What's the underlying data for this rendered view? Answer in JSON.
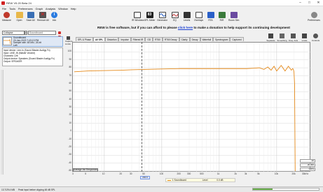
{
  "window": {
    "title": "REW V5.20 Beta 24"
  },
  "menu": [
    "File",
    "Tools",
    "Preferences",
    "Graph",
    "Analysis",
    "Window",
    "Help"
  ],
  "toolbar": {
    "items": [
      {
        "label": "Measure"
      },
      {
        "label": "Open"
      },
      {
        "label": "Save All"
      },
      {
        "label": "Remove All"
      },
      {
        "label": "Info"
      },
      {
        "label": "IR Windows"
      },
      {
        "label": "SPL Meter"
      },
      {
        "label": "Generator"
      },
      {
        "label": "EQ"
      },
      {
        "label": "Levels"
      },
      {
        "label": "Overlays"
      },
      {
        "label": "RTA"
      },
      {
        "label": "RIR"
      },
      {
        "label": "Room Sim"
      },
      {
        "label": "Preferences"
      }
    ],
    "spl_value": "83"
  },
  "banner": {
    "pre": "REW is free software, but if you can afford to please",
    "link": "click here",
    "post": "to make a donation to help support its continuing development"
  },
  "left": {
    "sort_label": "Collapse",
    "filter_value": "Soundboard",
    "card": {
      "line1": "Soundboard",
      "line2": "20-Jan-2023 7:43:13 PM",
      "line3": "Sample rate: 48 kHz, 24-bit",
      "line4": "Left"
    },
    "info": [
      "Input device: Line-In (Sound Blaster Audigy Fx)",
      "Input: LINE_IN (Master Volume)",
      "Channels: Left",
      "Output device: Speakers (Sound Blaster Audigy Fx)",
      "Output: SPEAKER"
    ]
  },
  "graph_controls": {
    "capture_label": "Capture",
    "limits_label": "Limits",
    "tabs": [
      "SPL & Phase",
      "All SPL",
      "Distortion",
      "Impulse",
      "Filtered IR",
      "GD",
      "RT60",
      "RT60 Decay",
      "Clarity",
      "Decay",
      "Waterfall",
      "Spectrogram",
      "Captured"
    ],
    "active_tab": "All SPL",
    "right_buttons": [
      {
        "label": "Separate"
      },
      {
        "label": "Smoothing"
      },
      {
        "label": "Freq. Axis"
      },
      {
        "label": "Limits"
      },
      {
        "label": "Controls"
      }
    ]
  },
  "chart_data": {
    "type": "line",
    "title": "",
    "xlabel": "Hz",
    "ylabel": "",
    "x_scale": "log",
    "xlim": [
      3,
      30000
    ],
    "ylim": [
      -50,
      110
    ],
    "y_ticks": [
      "100",
      "90",
      "80",
      "70",
      "60",
      "50",
      "40",
      "30",
      "20",
      "10",
      "0",
      "-10",
      "-20",
      "-30",
      "-40",
      "-50"
    ],
    "x_ticks": [
      {
        "v": 3,
        "label": "3"
      },
      {
        "v": 5,
        "label": "5"
      },
      {
        "v": 10,
        "label": "10"
      },
      {
        "v": 20,
        "label": "20"
      },
      {
        "v": 30,
        "label": "30"
      },
      {
        "v": 50,
        "label": "50"
      },
      {
        "v": 100,
        "label": "100"
      },
      {
        "v": 200,
        "label": "200"
      },
      {
        "v": 300,
        "label": "300"
      },
      {
        "v": 500,
        "label": "500"
      },
      {
        "v": 1000,
        "label": "1k"
      },
      {
        "v": 2000,
        "label": "2k"
      },
      {
        "v": 3000,
        "label": "3k"
      },
      {
        "v": 5000,
        "label": "5k"
      },
      {
        "v": 10000,
        "label": "10k"
      },
      {
        "v": 20000,
        "label": "20k"
      },
      {
        "v": 30000,
        "label": "30kHz"
      }
    ],
    "grid": true,
    "series": [
      {
        "name": "Soundboard",
        "color": "#e68a1a",
        "x": [
          3,
          5,
          10,
          20,
          30,
          50,
          100,
          200,
          300,
          500,
          1000,
          2000,
          3000,
          4000,
          5000,
          6000,
          7000,
          8000,
          9000,
          10000,
          12000,
          14000,
          16000,
          18000,
          19000,
          19500,
          20000,
          20500,
          21000
        ],
        "y": [
          75,
          76,
          76.5,
          77,
          77.5,
          78,
          78.5,
          79,
          79,
          79,
          79,
          79,
          79,
          79.5,
          80,
          78,
          81,
          77,
          82,
          76,
          83,
          76,
          82,
          77,
          79,
          78,
          75,
          60,
          -50
        ]
      }
    ]
  },
  "cursor": {
    "freq_value": "200.0"
  },
  "range_boxes": [
    "20",
    "20,000",
    "100%"
  ],
  "avg_button": "Average the Responses",
  "legend": {
    "text": "1 Soundboard",
    "level_label": "Level",
    "level_value": "0.0 dB"
  },
  "status": {
    "mem": "13.7/29.4 MB",
    "hint": "Peak input before clipping 48 dB SPL"
  },
  "colors": {
    "trace": "#e68a1a",
    "link": "#1a3fd0"
  }
}
